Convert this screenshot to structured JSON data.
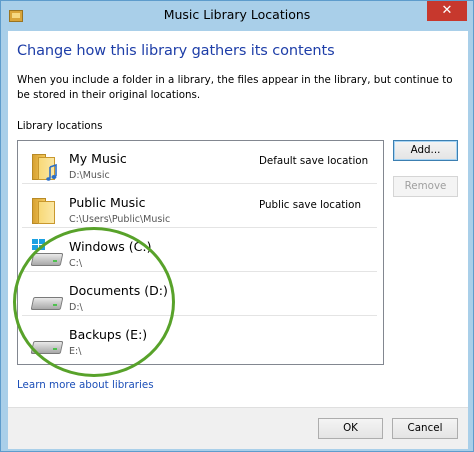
{
  "window": {
    "title": "Music Library Locations",
    "close_glyph": "✕"
  },
  "header": {
    "heading": "Change how this library gathers its contents",
    "description": "When you include a folder in a library, the files appear in the library, but continue to be stored in their original locations."
  },
  "locations": {
    "label": "Library locations",
    "items": [
      {
        "name": "My Music",
        "path": "D:\\Music",
        "note": "Default save location",
        "icon": "music-folder-icon"
      },
      {
        "name": "Public Music",
        "path": "C:\\Users\\Public\\Music",
        "note": "Public save location",
        "icon": "music-folder-icon"
      },
      {
        "name": "Windows (C:)",
        "path": "C:\\",
        "note": "",
        "icon": "windows-drive-icon"
      },
      {
        "name": "Documents (D:)",
        "path": "D:\\",
        "note": "",
        "icon": "drive-icon"
      },
      {
        "name": "Backups (E:)",
        "path": "E:\\",
        "note": "",
        "icon": "drive-icon"
      }
    ]
  },
  "buttons": {
    "add": "Add...",
    "remove": "Remove",
    "ok": "OK",
    "cancel": "Cancel"
  },
  "links": {
    "learn_more": "Learn more about libraries"
  },
  "colors": {
    "title_bar": "#a9cfe9",
    "heading": "#1e3ea8",
    "link": "#1c4fb8",
    "annotation": "#58a22a",
    "close_button": "#c7382d"
  }
}
